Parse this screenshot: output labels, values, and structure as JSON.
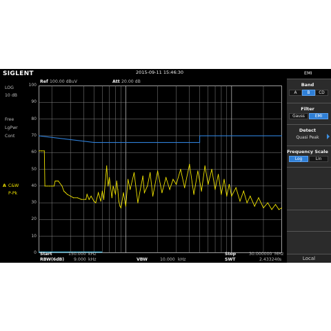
{
  "header": {
    "brand": "SIGLENT",
    "datetime": "2015-09-11  15:46:30",
    "mode": "EMI",
    "ref_label": "Ref",
    "ref_value": "100.00 dBuV",
    "att_label": "Att",
    "att_value": "20.00 dB"
  },
  "left_panel": {
    "scale_type": "LOG",
    "scale_div": "10 dB",
    "trigger": "Free",
    "detector": "LgPwr",
    "sweep": "Cont",
    "trace_a": "A",
    "trace_a_mode": "C&W",
    "trace_a_det": "P-Pk"
  },
  "footer": {
    "start_label": "Start",
    "start_value": "150.000",
    "start_unit": "kHz",
    "rbw_label": "RBW(6dB)",
    "rbw_value": "9.000",
    "rbw_unit": "kHz",
    "vbw_label": "VBW",
    "vbw_value": "10.000",
    "vbw_unit": "kHz",
    "stop_label": "Stop",
    "stop_value": "30.000000",
    "stop_unit": "MHz",
    "swt_label": "SWT",
    "swt_value": "2.433240",
    "swt_unit": "s"
  },
  "menu": {
    "band": {
      "title": "Band",
      "options": [
        "A",
        "B",
        "CD"
      ],
      "selected": "B"
    },
    "filter": {
      "title": "Filter",
      "options": [
        "Gauss",
        "EMI"
      ],
      "selected": "EMI"
    },
    "detect": {
      "title": "Detect",
      "value": "Quasi Peak"
    },
    "freq_scale": {
      "title": "Frequency Scale",
      "options": [
        "Log",
        "Lin"
      ],
      "selected": "Log"
    },
    "local_label": "Local"
  },
  "colors": {
    "trace": "#f0e300",
    "limit": "#2e7fd8",
    "selected": "#2f7fd6",
    "grid": "#8a8a8a"
  },
  "chart_data": {
    "type": "line",
    "x_scale": "log",
    "x_range_mhz": [
      0.15,
      30
    ],
    "ylim": [
      0,
      100
    ],
    "yticks": [
      0,
      10,
      20,
      30,
      40,
      50,
      60,
      70,
      80,
      90,
      100
    ],
    "grid": true,
    "limit_line": {
      "name": "",
      "x": [
        0.15,
        0.5,
        5,
        5,
        30
      ],
      "y": [
        70,
        66,
        66,
        70,
        70
      ]
    },
    "trace": {
      "x": [
        0.15,
        0.16,
        0.17,
        0.172,
        0.18,
        0.19,
        0.2,
        0.21,
        0.215,
        0.23,
        0.25,
        0.26,
        0.27,
        0.28,
        0.3,
        0.32,
        0.35,
        0.38,
        0.42,
        0.43,
        0.45,
        0.47,
        0.5,
        0.52,
        0.55,
        0.58,
        0.6,
        0.62,
        0.66,
        0.68,
        0.7,
        0.74,
        0.76,
        0.8,
        0.82,
        0.84,
        0.86,
        0.88,
        0.9,
        0.95,
        1.0,
        1.05,
        1.1,
        1.2,
        1.3,
        1.45,
        1.5,
        1.6,
        1.7,
        1.8,
        2.0,
        2.2,
        2.4,
        2.6,
        2.8,
        3.0,
        3.3,
        3.6,
        4.0,
        4.4,
        4.8,
        5.2,
        5.6,
        6.0,
        6.5,
        7.0,
        7.5,
        8.0,
        8.5,
        9.0,
        9.5,
        10.0,
        11.0,
        12.0,
        13.0,
        14.0,
        15.0,
        16.5,
        18.0,
        20.0,
        22.0,
        24.0,
        26.0,
        28.0,
        30.0
      ],
      "y": [
        61,
        61,
        61,
        40,
        40,
        40,
        40,
        40,
        43,
        43,
        40,
        37,
        36,
        35,
        34,
        33,
        33,
        32,
        32,
        35,
        32,
        34,
        31,
        30,
        36,
        31,
        37,
        32,
        52,
        40,
        45,
        33,
        40,
        35,
        43,
        38,
        31,
        28,
        27,
        36,
        28,
        44,
        38,
        48,
        30,
        46,
        36,
        40,
        48,
        34,
        49,
        36,
        45,
        38,
        44,
        41,
        50,
        39,
        53,
        35,
        49,
        37,
        52,
        41,
        50,
        38,
        47,
        35,
        44,
        34,
        41,
        34,
        39,
        31,
        37,
        30,
        34,
        28,
        33,
        27,
        30,
        26,
        29,
        26,
        27
      ]
    }
  }
}
